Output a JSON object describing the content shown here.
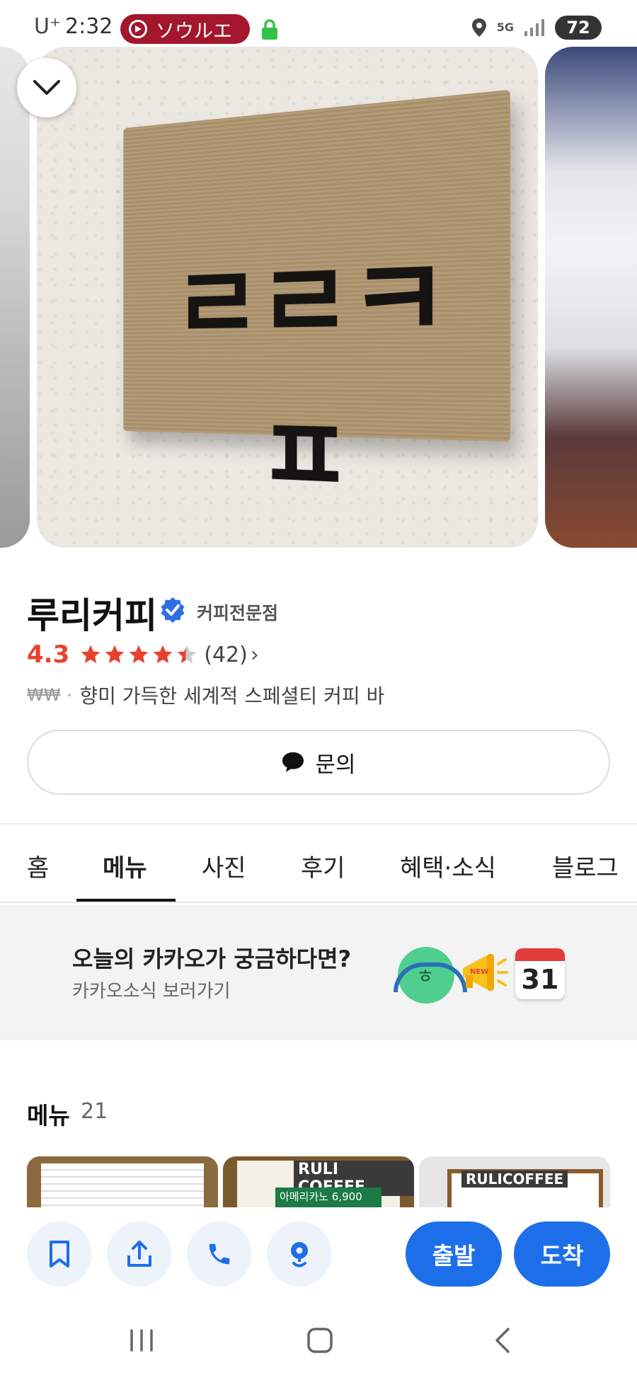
{
  "status_bar": {
    "carrier": "U⁺",
    "time": "2:32",
    "recording_label": "ソウルエ",
    "network": "5G",
    "battery": "72"
  },
  "place": {
    "name": "루리커피",
    "category": "커피전문점",
    "rating": "4.3",
    "review_count": "(42)",
    "price_level": "₩₩",
    "description": "향미 가득한 세계적 스페셜티 커피 바",
    "sign_text": "ㄹㄹㅋㅍ"
  },
  "inquiry_button": {
    "label": "문의"
  },
  "tabs": [
    {
      "label": "홈"
    },
    {
      "label": "메뉴"
    },
    {
      "label": "사진"
    },
    {
      "label": "후기"
    },
    {
      "label": "혜택·소식"
    },
    {
      "label": "블로그"
    }
  ],
  "active_tab": "메뉴",
  "banner": {
    "title": "오늘의 카카오가 궁금하다면?",
    "subtitle": "카카오소식 보러가기",
    "calendar_number": "31"
  },
  "menu_section": {
    "heading": "메뉴",
    "count": "21",
    "thumb_2_logo": "RULI COFFEE",
    "thumb_2_item": "아메리카노 6,900",
    "thumb_3_logo": "RULICOFFEE"
  },
  "actions": {
    "depart_label": "출발",
    "arrive_label": "도착"
  },
  "colors": {
    "accent_blue": "#1c6fe8",
    "rating_red": "#e8412b",
    "star_red": "#e8412b",
    "verified_blue": "#2f6fe0"
  },
  "icons": [
    "chevron-down-icon",
    "verified-badge-icon",
    "star-icon",
    "chat-bubble-icon",
    "bookmark-icon",
    "share-icon",
    "phone-icon",
    "pin-icon",
    "recents-icon",
    "home-icon",
    "back-icon"
  ]
}
